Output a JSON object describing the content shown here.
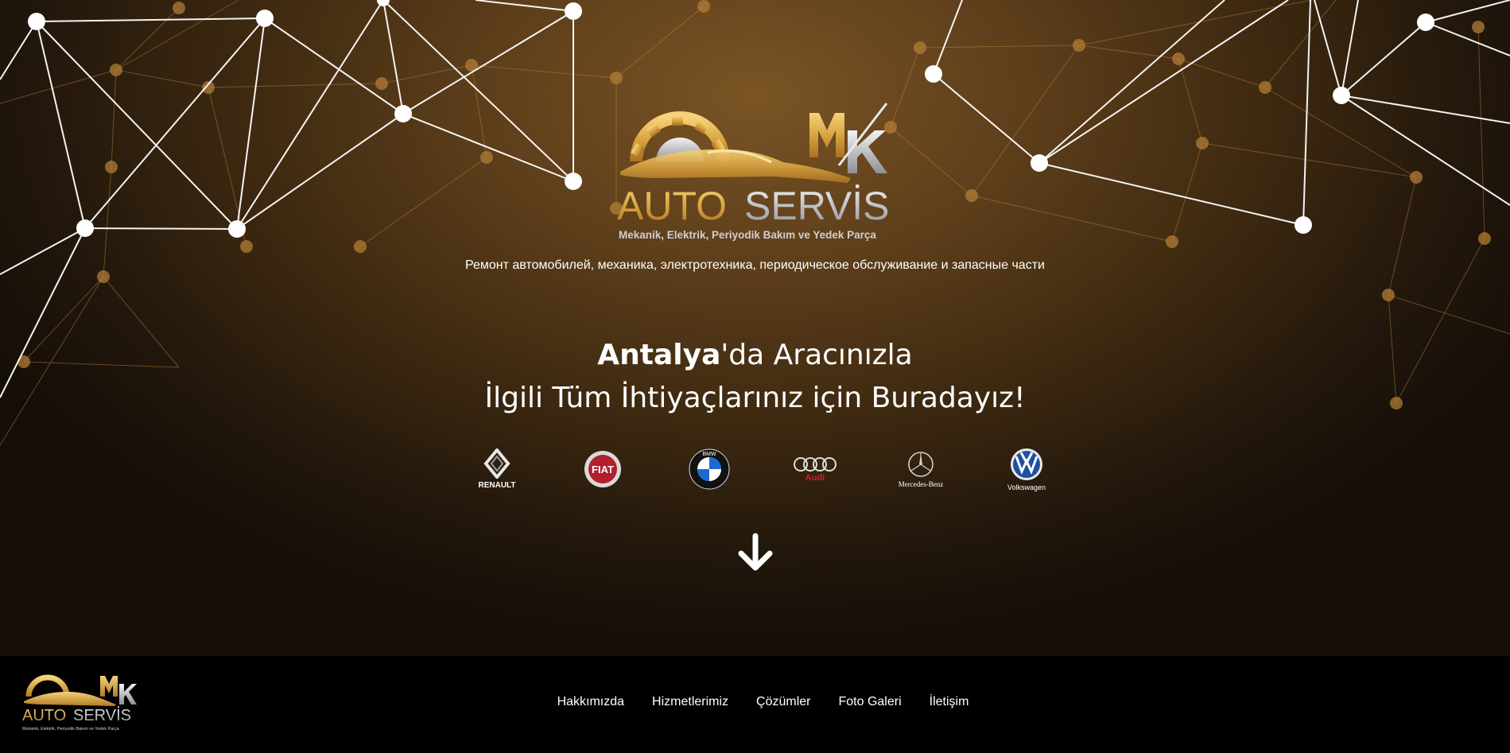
{
  "logo": {
    "monogram": "MK",
    "word1": "AUTO",
    "word2": "SERVİS",
    "subtitle": "Mekanik, Elektrik, Periyodik Bakım ve Yedek Parça"
  },
  "tagline_ru": "Ремонт автомобилей, механика, электротехника, периодическое обслуживание и запасные части",
  "headline": {
    "city": "Antalya",
    "line1_rest": "'da Aracınızla",
    "line2": "İlgili Tüm İhtiyaçlarınız için Buradayız!"
  },
  "brands": [
    {
      "name": "RENAULT",
      "icon": "renault-icon"
    },
    {
      "name": "FIAT",
      "icon": "fiat-icon"
    },
    {
      "name": "BMW",
      "icon": "bmw-icon"
    },
    {
      "name": "Audi",
      "icon": "audi-icon"
    },
    {
      "name": "Mercedes-Benz",
      "icon": "mercedes-icon"
    },
    {
      "name": "Volkswagen",
      "icon": "volkswagen-icon"
    }
  ],
  "scroll_icon": "arrow-down-icon",
  "nav": {
    "items": [
      "Hakkımızda",
      "Hizmetlerimiz",
      "Çözümler",
      "Foto Galeri",
      "İletişim"
    ]
  },
  "colors": {
    "gold": "#d9a441",
    "silver": "#b9bcc2",
    "footer_bg": "#000000"
  }
}
